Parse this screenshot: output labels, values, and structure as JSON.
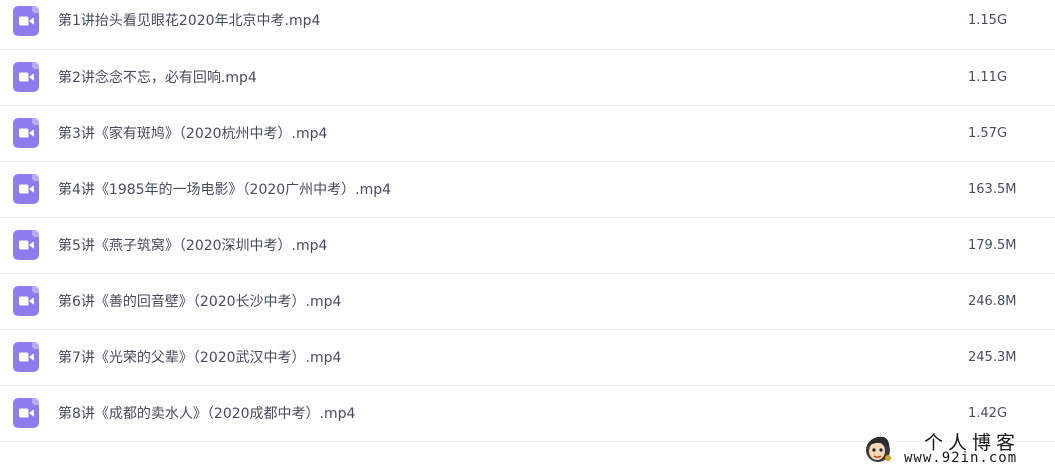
{
  "colors": {
    "icon_bg": "#8b7cf0",
    "text": "#454d5a",
    "divider": "#eeeff2"
  },
  "files": [
    {
      "icon": "video-file-icon",
      "name": "第1讲抬头看见眼花2020年北京中考.mp4",
      "size": "1.15G"
    },
    {
      "icon": "video-file-icon",
      "name": "第2讲念念不忘，必有回响.mp4",
      "size": "1.11G"
    },
    {
      "icon": "video-file-icon",
      "name": "第3讲《家有斑鸠》（2020杭州中考）.mp4",
      "size": "1.57G"
    },
    {
      "icon": "video-file-icon",
      "name": "第4讲《1985年的一场电影》（2020广州中考）.mp4",
      "size": "163.5M"
    },
    {
      "icon": "video-file-icon",
      "name": "第5讲《燕子筑窝》（2020深圳中考）.mp4",
      "size": "179.5M"
    },
    {
      "icon": "video-file-icon",
      "name": "第6讲《善的回音壁》（2020长沙中考）.mp4",
      "size": "246.8M"
    },
    {
      "icon": "video-file-icon",
      "name": "第7讲《光荣的父辈》（2020武汉中考）.mp4",
      "size": "245.3M"
    },
    {
      "icon": "video-file-icon",
      "name": "第8讲《成都的卖水人》（2020成都中考）.mp4",
      "size": "1.42G"
    }
  ],
  "watermark": {
    "title": "个人博客",
    "url": "www.92in.com"
  }
}
